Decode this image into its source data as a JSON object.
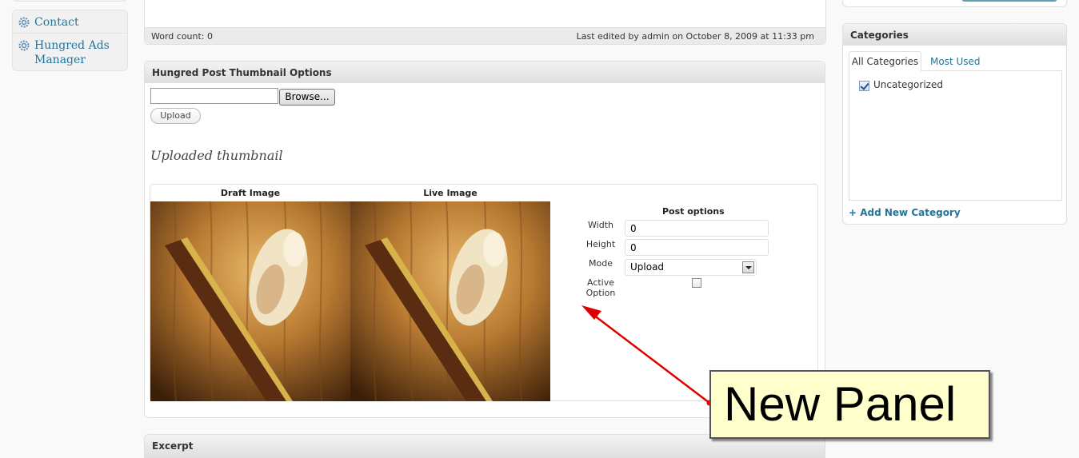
{
  "sidebar": {
    "items": [
      {
        "label": "Contact",
        "icon": "gear-icon"
      },
      {
        "label": "Hungred Ads Manager",
        "icon": "gear-icon"
      }
    ]
  },
  "editor": {
    "word_count_label": "Word count:",
    "word_count": "0",
    "last_edited": "Last edited by admin on October 8, 2009 at 11:33 pm"
  },
  "thumbnail_panel": {
    "title": "Hungred Post Thumbnail Options",
    "browse_label": "Browse...",
    "upload_label": "Upload",
    "uploaded_heading": "Uploaded thumbnail",
    "draft_label": "Draft Image",
    "live_label": "Live Image",
    "post_options": {
      "title": "Post options",
      "width_label": "Width",
      "width_value": "0",
      "height_label": "Height",
      "height_value": "0",
      "mode_label": "Mode",
      "mode_value": "Upload",
      "active_label": "Active Option"
    }
  },
  "excerpt": {
    "title": "Excerpt"
  },
  "categories": {
    "title": "Categories",
    "tab_all": "All Categories",
    "tab_used": "Most Used",
    "items": [
      {
        "label": "Uncategorized",
        "checked": true
      }
    ],
    "add_new": "+ Add New Category"
  },
  "annotation": {
    "text": "New Panel",
    "color": "#ffffcc",
    "arrow_color": "#dd0000"
  },
  "colors": {
    "link": "#21759b",
    "background": "#f9f9f9"
  }
}
